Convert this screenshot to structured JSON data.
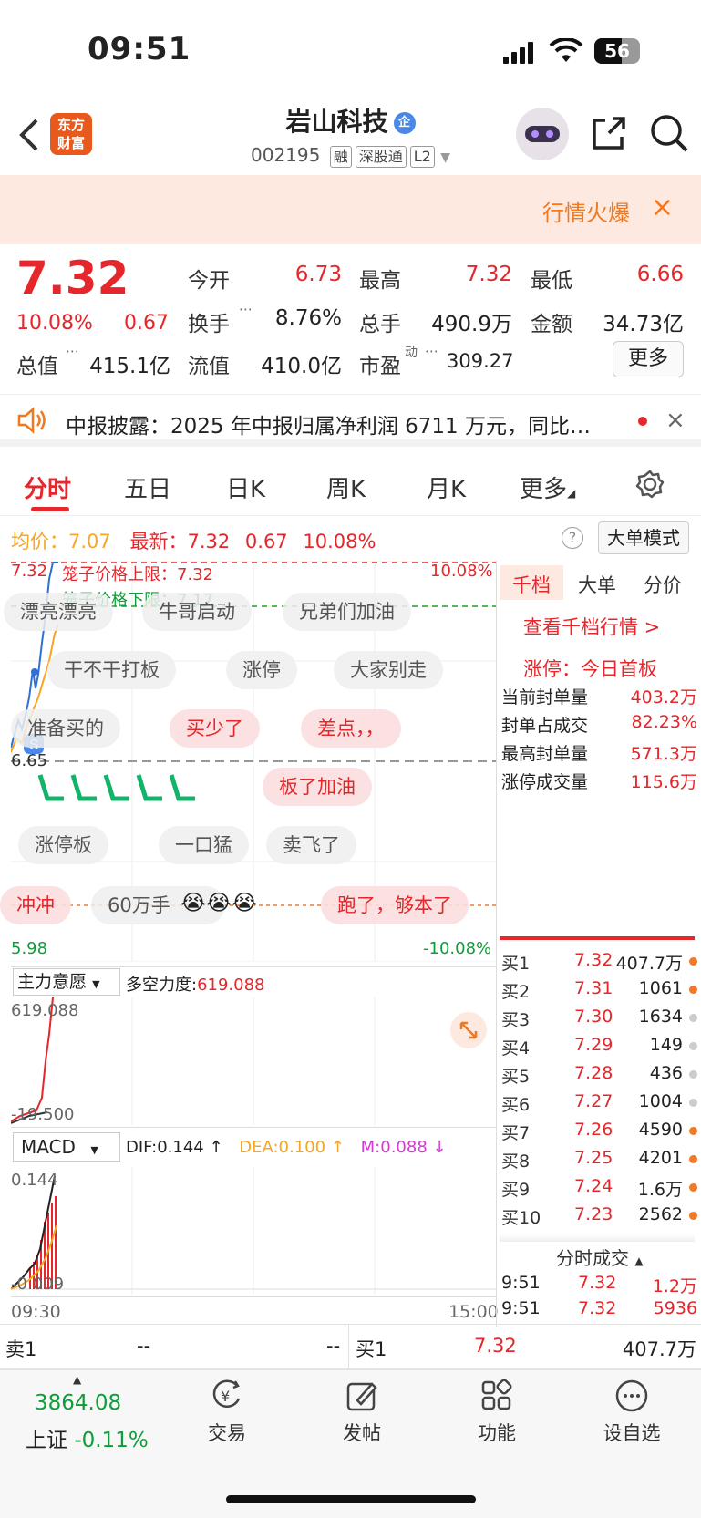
{
  "status_bar": {
    "time": "09:51",
    "battery": "56"
  },
  "header": {
    "logo_line1": "东方",
    "logo_line2": "财富",
    "title": "岩山科技",
    "badge": "企",
    "code": "002195",
    "tags": [
      "融",
      "深股通",
      "L2"
    ]
  },
  "banner": {
    "text": "行情火爆",
    "close": "×"
  },
  "quote": {
    "price": "7.32",
    "change_pct": "10.08%",
    "change": "0.67",
    "cells": [
      {
        "label": "今开",
        "value": "6.73",
        "color": "red"
      },
      {
        "label": "最高",
        "value": "7.32",
        "color": "red"
      },
      {
        "label": "最低",
        "value": "6.66",
        "color": "red"
      },
      {
        "label": "换手",
        "value": "8.76%",
        "color": "black"
      },
      {
        "label": "总手",
        "value": "490.9万",
        "color": "black"
      },
      {
        "label": "金额",
        "value": "34.73亿",
        "color": "black"
      },
      {
        "label": "总值",
        "value": "415.1亿",
        "color": "black"
      },
      {
        "label": "流值",
        "value": "410.0亿",
        "color": "black"
      },
      {
        "label": "市盈",
        "value": "309.27",
        "color": "black"
      }
    ],
    "pe_sup": "动",
    "more": "更多"
  },
  "news": {
    "text": "中报披露：2025 年中报归属净利润 6711 万元，同比…"
  },
  "tabs": [
    "分时",
    "五日",
    "日K",
    "周K",
    "月K",
    "更多"
  ],
  "chart_info": {
    "avg_label": "均价：",
    "avg": "7.07",
    "latest_label": "最新：",
    "latest": "7.32",
    "chg": "0.67",
    "pct": "10.08%",
    "big_order_mode": "大单模式"
  },
  "intraday": {
    "y_top": "7.32",
    "y_mid": "6.65",
    "y_bottom": "5.98",
    "pct_top": "10.08%",
    "pct_bottom": "-10.08%",
    "cage_upper": "笼子价格上限：7.32",
    "cage_lower": "笼子价格下限：7.17",
    "time_start": "09:30",
    "time_end": "15:00"
  },
  "bubbles": [
    "漂亮漂亮",
    "牛哥启动",
    "兄弟们加油",
    "干不干打板",
    "涨停",
    "大家别走",
    "准备买的",
    "买少了",
    "差点，，",
    "板了加油",
    "涨停板",
    "一口猛",
    "卖飞了",
    "冲冲",
    "60万手",
    "跑了，够本了"
  ],
  "indicator1": {
    "name": "主力意愿",
    "label": "多空力度:",
    "value": "619.088",
    "top": "619.088",
    "bottom": "-19.500"
  },
  "macd": {
    "name": "MACD",
    "dif": "DIF:0.144 ↑",
    "dea": "DEA:0.100 ↑",
    "m": "M:0.088 ↓",
    "top": "0.144",
    "bottom": "-0.009"
  },
  "side": {
    "tabs": [
      "千档",
      "大单",
      "分价"
    ],
    "link": "查看千档行情 >",
    "limit_title": "涨停：今日首板",
    "fengban": [
      {
        "label": "当前封单量",
        "value": "403.2万"
      },
      {
        "label": "封单占成交",
        "value": "82.23%"
      },
      {
        "label": "最高封单量",
        "value": "571.3万"
      },
      {
        "label": "涨停成交量",
        "value": "115.6万"
      }
    ],
    "buy_levels": [
      {
        "label": "买1",
        "price": "7.32",
        "vol": "407.7万",
        "dot": "#f07a2a"
      },
      {
        "label": "买2",
        "price": "7.31",
        "vol": "1061",
        "dot": "#f07a2a"
      },
      {
        "label": "买3",
        "price": "7.30",
        "vol": "1634",
        "dot": "#cccccc"
      },
      {
        "label": "买4",
        "price": "7.29",
        "vol": "149",
        "dot": "#cccccc"
      },
      {
        "label": "买5",
        "price": "7.28",
        "vol": "436",
        "dot": "#cccccc"
      },
      {
        "label": "买6",
        "price": "7.27",
        "vol": "1004",
        "dot": "#cccccc"
      },
      {
        "label": "买7",
        "price": "7.26",
        "vol": "4590",
        "dot": "#f07a2a"
      },
      {
        "label": "买8",
        "price": "7.25",
        "vol": "4201",
        "dot": "#f07a2a"
      },
      {
        "label": "买9",
        "price": "7.24",
        "vol": "1.6万",
        "dot": "#f07a2a"
      },
      {
        "label": "买10",
        "price": "7.23",
        "vol": "2562",
        "dot": "#f07a2a"
      }
    ],
    "trades_title": "分时成交",
    "trades": [
      {
        "time": "9:51",
        "price": "7.32",
        "vol": "1.2万"
      },
      {
        "time": "9:51",
        "price": "7.32",
        "vol": "5936"
      }
    ]
  },
  "order_strip": {
    "sell_label": "卖1",
    "sell_price": "--",
    "sell_vol": "--",
    "buy_label": "买1",
    "buy_price": "7.32",
    "buy_vol": "407.7万"
  },
  "bottom_nav": {
    "index_value": "3864.08",
    "index_name": "上证",
    "index_pct": "-0.11%",
    "items": [
      "交易",
      "发帖",
      "功能",
      "设自选"
    ]
  },
  "colors": {
    "up": "#e5262b",
    "down": "#0f9d3a",
    "accent": "#f2781e"
  }
}
